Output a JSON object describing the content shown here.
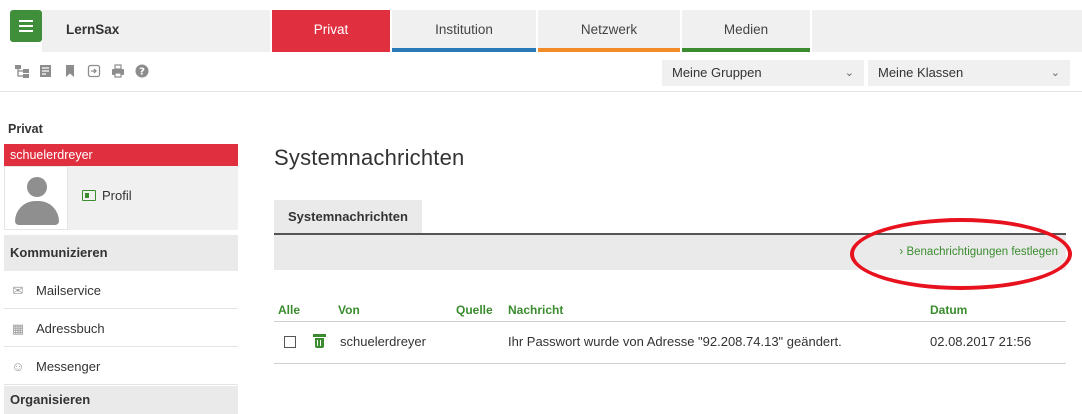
{
  "app": {
    "brand": "LernSax"
  },
  "top_tabs": [
    {
      "label": "Privat"
    },
    {
      "label": "Institution"
    },
    {
      "label": "Netzwerk"
    },
    {
      "label": "Medien"
    }
  ],
  "toolbar": {
    "icons": [
      "sitemap-icon",
      "notes-icon",
      "bookmark-icon",
      "logout-icon",
      "print-icon",
      "help-icon"
    ],
    "groups_select": "Meine Gruppen",
    "classes_select": "Meine Klassen"
  },
  "sidebar": {
    "heading": "Privat",
    "user": "schuelerdreyer",
    "profile_link": "Profil",
    "sections": {
      "kommunizieren": "Kommunizieren",
      "organisieren": "Organisieren"
    },
    "items": [
      {
        "label": "Mailservice",
        "icon": "mail-icon"
      },
      {
        "label": "Adressbuch",
        "icon": "address-book-icon"
      },
      {
        "label": "Messenger",
        "icon": "messenger-icon"
      }
    ]
  },
  "main": {
    "title": "Systemnachrichten",
    "subtab": "Systemnachrichten",
    "action_link": "Benachrichtigungen festlegen",
    "table": {
      "headers": {
        "alle": "Alle",
        "von": "Von",
        "quelle": "Quelle",
        "nachricht": "Nachricht",
        "datum": "Datum"
      },
      "rows": [
        {
          "von": "schuelerdreyer",
          "quelle": "",
          "nachricht": "Ihr Passwort wurde von Adresse \"92.208.74.13\" geändert.",
          "datum": "02.08.2017 21:56"
        }
      ]
    }
  },
  "colors": {
    "accent_red": "#e03040",
    "accent_green": "#3a8c2f",
    "institution_blue": "#2a7ab8",
    "netzwerk_orange": "#f28c28",
    "annotation_red": "#e8121e"
  }
}
